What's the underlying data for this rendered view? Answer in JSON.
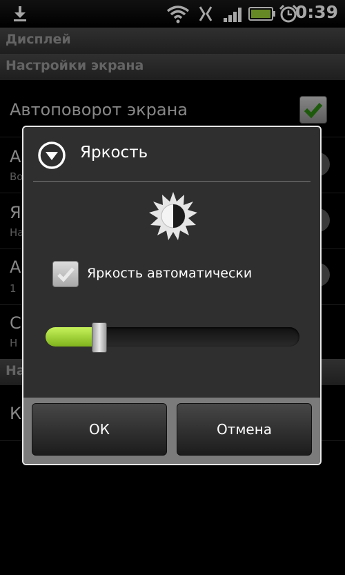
{
  "status_bar": {
    "time": "0:39",
    "icons": [
      "download-icon",
      "wifi-icon",
      "data-icon",
      "signal-icon",
      "battery-icon",
      "alarm-icon"
    ]
  },
  "background": {
    "section_title": "Дисплей",
    "subsection_title": "Настройки экрана",
    "items": [
      {
        "title": "Автоповорот экрана",
        "subtitle": "",
        "control": "checkbox",
        "checked": true
      },
      {
        "title": "А",
        "subtitle": "Во",
        "control": "round"
      },
      {
        "title": "Я",
        "subtitle": "На",
        "control": "round"
      },
      {
        "title": "А",
        "subtitle": "1",
        "control": "round"
      },
      {
        "title": "С",
        "subtitle": "Н",
        "control": "none"
      }
    ],
    "subsection2_title": "На",
    "last_item_title": "К"
  },
  "dialog": {
    "title": "Яркость",
    "auto_brightness_label": "Яркость автоматически",
    "auto_brightness_checked": true,
    "brightness_level": 0.21,
    "ok_label": "ОК",
    "cancel_label": "Отмена"
  },
  "colors": {
    "accent_green": "#9ed33a",
    "dialog_bg": "#2f2f2f",
    "button_bar": "#7b7b7b"
  }
}
